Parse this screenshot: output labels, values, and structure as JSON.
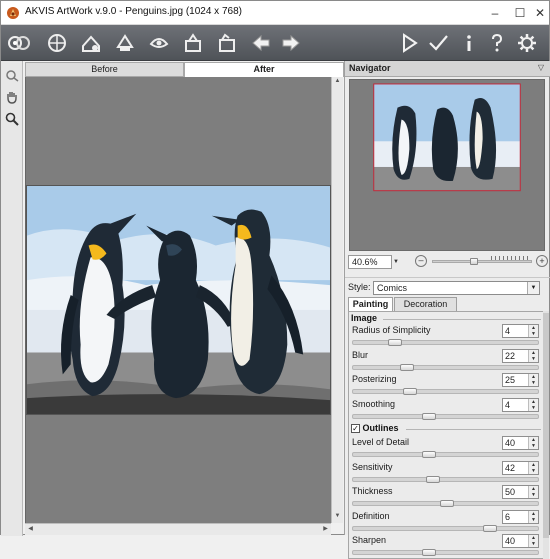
{
  "window": {
    "title": "AKVIS ArtWork v.9.0 - Penguins.jpg (1024 x 768)",
    "minimize": "–",
    "maximize": "☐",
    "close": "✕"
  },
  "toolbar": {
    "left_icons": [
      "open-image-icon",
      "process-icon",
      "save-image-icon",
      "batch-icon",
      "print-icon",
      "share-icon",
      "presets-icon"
    ],
    "right_icons": [
      "undo-icon",
      "redo-icon",
      "run-icon",
      "apply-icon",
      "info-icon",
      "help-icon",
      "settings-icon"
    ]
  },
  "left_tools": [
    "hand-with-brush-icon",
    "hand-icon",
    "zoom-icon"
  ],
  "view_tabs": {
    "before": "Before",
    "after": "After",
    "active": "after"
  },
  "navigator": {
    "title": "Navigator",
    "zoom": "40.6%",
    "zoom_level": 0.406
  },
  "style": {
    "label": "Style:",
    "value": "Comics"
  },
  "panel_tabs": {
    "painting": "Painting",
    "decoration": "Decoration",
    "active": "painting"
  },
  "groups": {
    "image": {
      "title": "Image"
    },
    "outlines": {
      "title": "Outlines",
      "checked": true
    }
  },
  "image_params": [
    {
      "label": "Radius of Simplicity",
      "value": "4",
      "level": 0.2
    },
    {
      "label": "Blur",
      "value": "22",
      "level": 0.27
    },
    {
      "label": "Posterizing",
      "value": "25",
      "level": 0.29
    },
    {
      "label": "Smoothing",
      "value": "4",
      "level": 0.4
    }
  ],
  "outline_params": [
    {
      "label": "Level of Detail",
      "value": "40",
      "level": 0.4
    },
    {
      "label": "Sensitivity",
      "value": "42",
      "level": 0.42
    },
    {
      "label": "Thickness",
      "value": "50",
      "level": 0.5
    },
    {
      "label": "Definition",
      "value": "6",
      "level": 0.75
    },
    {
      "label": "Sharpen",
      "value": "40",
      "level": 0.4
    }
  ],
  "colors": {
    "toolbar": "#5d6066",
    "canvas_bg": "#7e7e7e",
    "sky": "#aecde9",
    "ground": "#8b8b8b"
  }
}
